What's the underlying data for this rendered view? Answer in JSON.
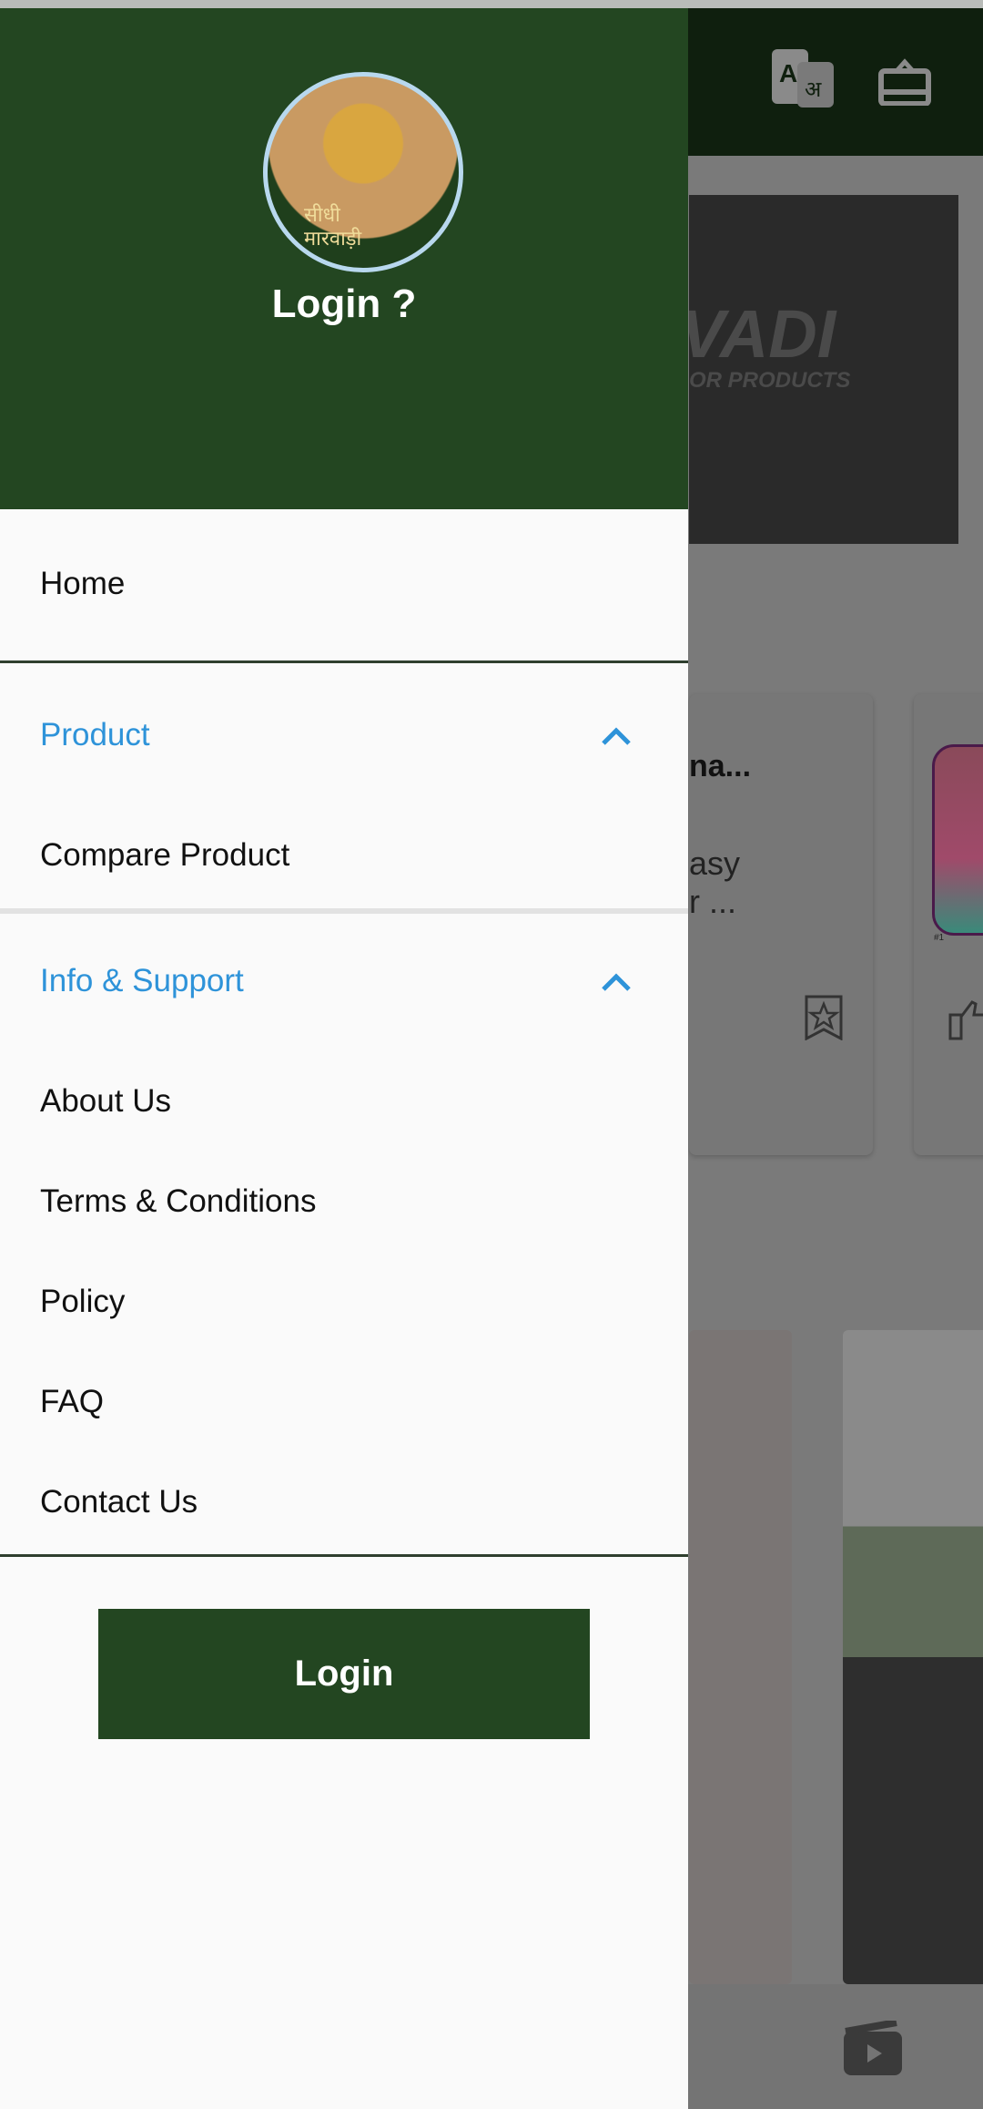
{
  "background": {
    "banner_text": "VADI",
    "banner_subtext": "OR PRODUCTS",
    "card_title": "na...",
    "card_desc_line1": "asy",
    "card_desc_line2": "r ...",
    "card2_badge": "#1",
    "icons": [
      "translate-icon",
      "gift-icon",
      "bookmark-star-icon",
      "thumbs-up-icon",
      "video-play-icon"
    ]
  },
  "drawer": {
    "header_title": "Login ?",
    "logo_text_line1": "सीधी",
    "logo_text_line2": "मारवाड़ी",
    "items": {
      "home": "Home",
      "product": "Product",
      "compare_product": "Compare Product",
      "info_support": "Info & Support",
      "about": "About Us",
      "terms": "Terms & Conditions",
      "policy": "Policy",
      "faq": "FAQ",
      "contact": "Contact Us"
    },
    "login_button": "Login"
  },
  "colors": {
    "brand_green": "#234621",
    "section_blue": "#2e93d9"
  }
}
